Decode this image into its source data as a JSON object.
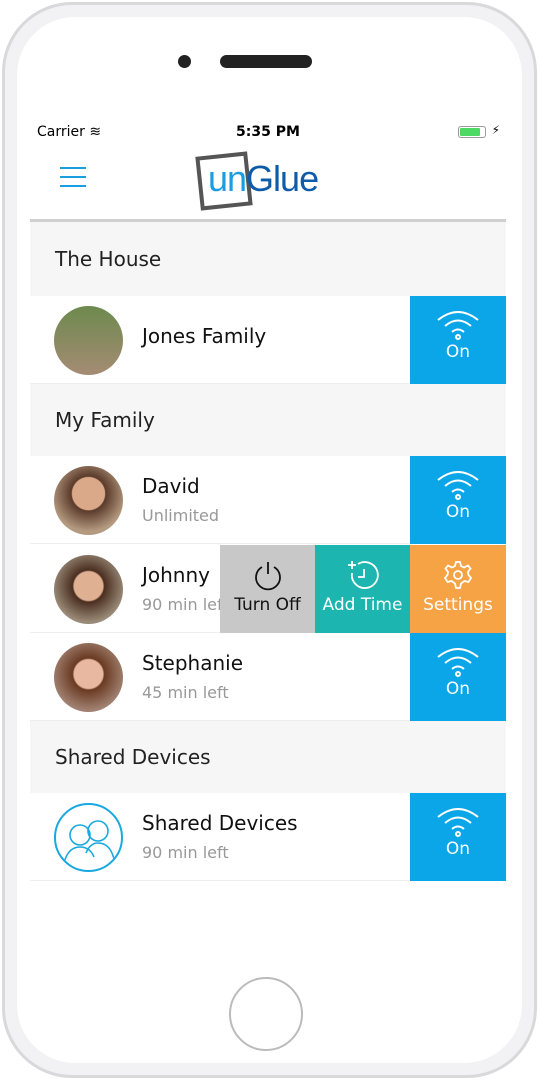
{
  "status": {
    "carrier": "Carrier",
    "time": "5:35 PM",
    "battery_level": 0.85
  },
  "header": {
    "logo_un": "un",
    "logo_glue": "Glue"
  },
  "sections": [
    {
      "title": "The House",
      "rows": [
        {
          "name": "Jones Family",
          "status": "On"
        }
      ]
    },
    {
      "title": "My Family",
      "rows": [
        {
          "name": "David",
          "sub": "Unlimited",
          "status": "On"
        },
        {
          "name": "Johnny",
          "sub": "90 min left"
        },
        {
          "name": "Stephanie",
          "sub": "45 min left",
          "status": "On"
        }
      ]
    },
    {
      "title": "Shared Devices",
      "rows": [
        {
          "name": "Shared Devices",
          "sub": "90 min left",
          "status": "On"
        }
      ]
    }
  ],
  "swipe_actions": {
    "turn_off": "Turn Off",
    "add_time": "Add Time",
    "settings": "Settings"
  },
  "colors": {
    "on": "#0aa6e8",
    "turn_off": "#c8c8c8",
    "add_time": "#1db5b0",
    "settings": "#f6a346",
    "brand": "#0d5ca8"
  }
}
